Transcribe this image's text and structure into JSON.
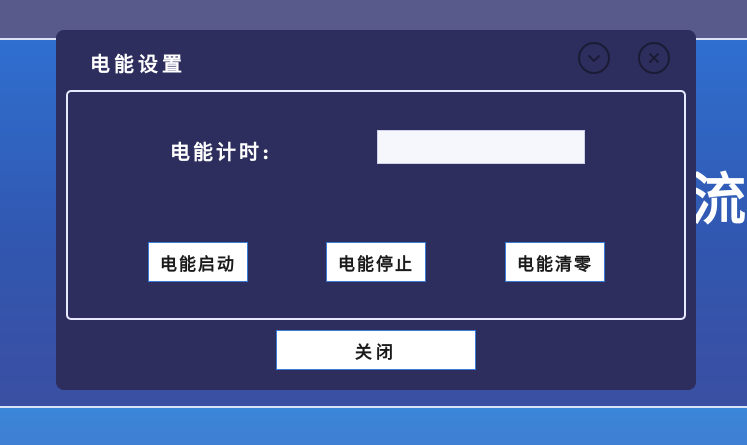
{
  "background": {
    "partial_title_char": "流"
  },
  "dialog": {
    "title": "电能设置",
    "minimize_icon": "chevron-down-circle-icon",
    "close_icon": "close-circle-icon",
    "timer": {
      "label": "电能计时:",
      "value": "",
      "placeholder": ""
    },
    "buttons": {
      "start": "电能启动",
      "stop": "电能停止",
      "clear": "电能清零"
    },
    "close_label": "关闭"
  },
  "colors": {
    "dialog_bg": "#2e2e5e",
    "page_band": "#3157b0",
    "button_border": "#3a7bd5"
  }
}
